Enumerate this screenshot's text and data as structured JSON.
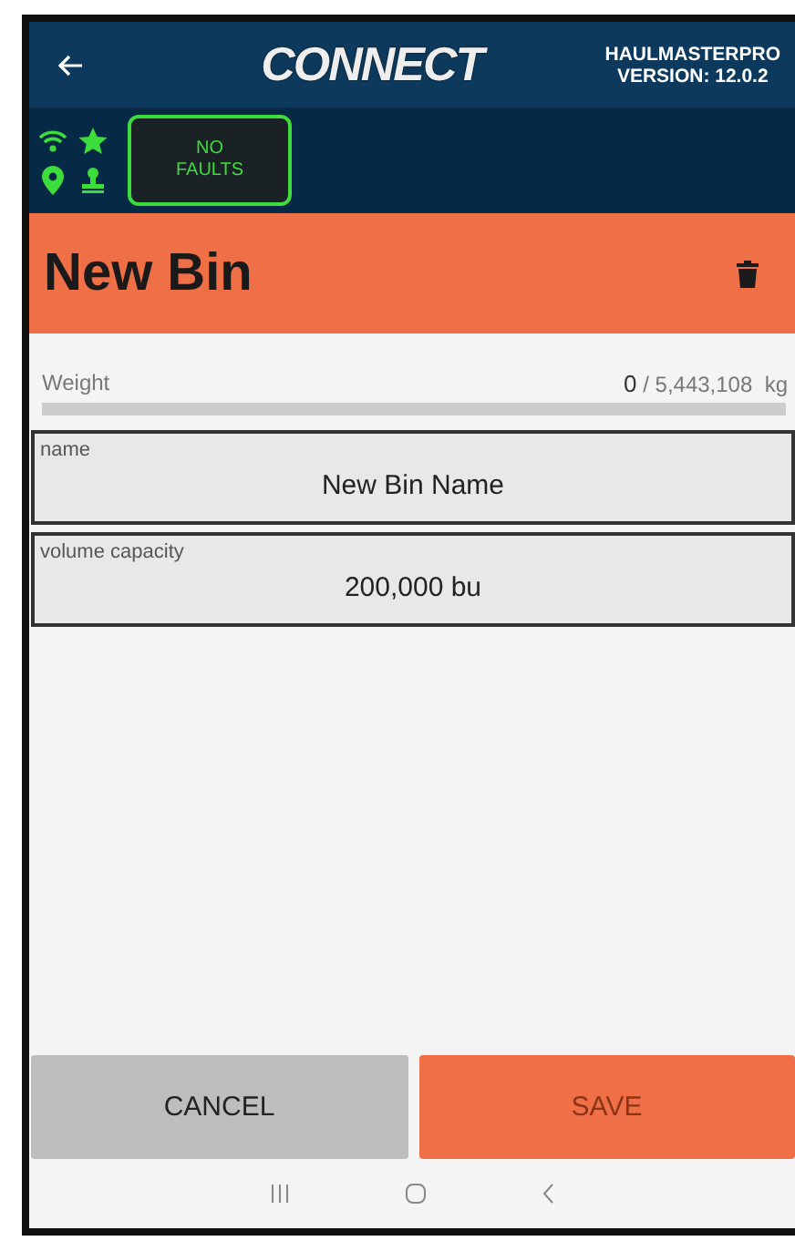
{
  "header": {
    "logo": "CONNECT",
    "app_name": "HAULMASTERPRO",
    "version": "VERSION: 12.0.2"
  },
  "status": {
    "faults": "NO FAULTS"
  },
  "title": "New Bin",
  "weight": {
    "label": "Weight",
    "current": "0",
    "capacity": "/ 5,443,108",
    "unit": "kg",
    "level": 0
  },
  "fields": [
    {
      "label": "name",
      "value": "New Bin Name"
    },
    {
      "label": "volume capacity",
      "value": "200,000 bu"
    }
  ],
  "buttons": [
    {
      "label": "CANCEL",
      "kind": "cancel",
      "disabled": false
    },
    {
      "label": "SAVE",
      "kind": "save",
      "disabled": true
    }
  ]
}
